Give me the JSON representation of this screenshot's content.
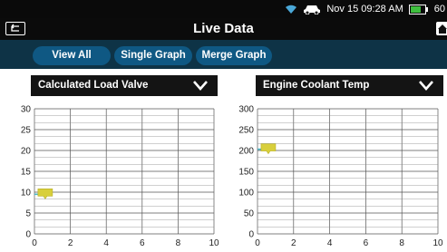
{
  "status": {
    "datetime": "Nov 15  09:28 AM",
    "battery": "60"
  },
  "header": {
    "title": "Live Data"
  },
  "tabs": [
    {
      "label": "View All"
    },
    {
      "label": "Single Graph"
    },
    {
      "label": "Merge Graph"
    }
  ],
  "panels": [
    {
      "label": "Calculated Load Valve"
    },
    {
      "label": "Engine Coolant Temp"
    }
  ],
  "colors": {
    "accent": "#0f5883",
    "marker": "#d8cf3c",
    "line": "#4bb7c8"
  },
  "icons": [
    "back-icon",
    "home-icon",
    "wifi-icon",
    "car-icon",
    "battery-icon",
    "chevron-down-icon"
  ],
  "chart_data": [
    {
      "type": "line",
      "title": "Calculated Load Valve",
      "x_ticks": [
        "0",
        "2",
        "4",
        "6",
        "8",
        "10"
      ],
      "y_ticks": [
        "0",
        "5",
        "10",
        "15",
        "20",
        "25",
        "30"
      ],
      "xlim": [
        0,
        10
      ],
      "ylim": [
        0,
        30
      ],
      "series": [
        {
          "values": [
            [
              0,
              9.5
            ],
            [
              0.6,
              9.5
            ]
          ]
        }
      ],
      "grid": true
    },
    {
      "type": "line",
      "title": "Engine Coolant Temp",
      "x_ticks": [
        "0",
        "2",
        "4",
        "6",
        "8",
        "10"
      ],
      "y_ticks": [
        "0",
        "50",
        "100",
        "150",
        "200",
        "250",
        "300"
      ],
      "xlim": [
        0,
        10
      ],
      "ylim": [
        0,
        300
      ],
      "series": [
        {
          "values": [
            [
              0,
              203
            ],
            [
              0.6,
              203
            ]
          ]
        }
      ],
      "grid": true
    }
  ]
}
